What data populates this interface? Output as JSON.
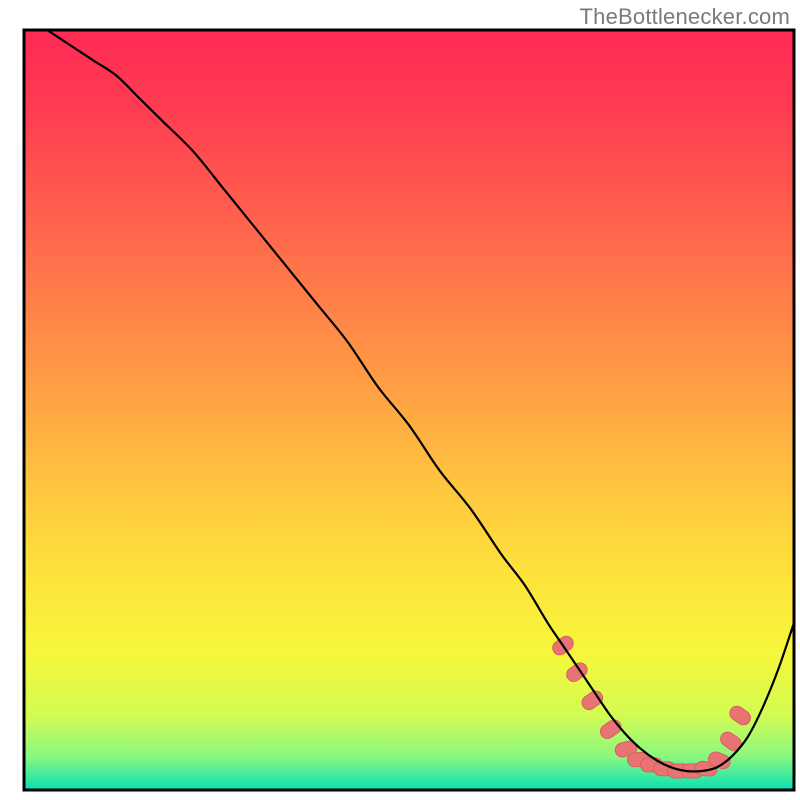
{
  "attribution": "TheBottlenecker.com",
  "chart_data": {
    "type": "line",
    "title": "",
    "xlabel": "",
    "ylabel": "",
    "xlim": [
      0,
      100
    ],
    "ylim": [
      0,
      100
    ],
    "grid": false,
    "background": {
      "type": "vertical-gradient",
      "stops": [
        {
          "offset": 0.0,
          "color": "#ff2a55"
        },
        {
          "offset": 0.1,
          "color": "#ff3b52"
        },
        {
          "offset": 0.22,
          "color": "#ff5a4e"
        },
        {
          "offset": 0.35,
          "color": "#ff7d49"
        },
        {
          "offset": 0.48,
          "color": "#ffa244"
        },
        {
          "offset": 0.6,
          "color": "#ffc53f"
        },
        {
          "offset": 0.72,
          "color": "#fee33b"
        },
        {
          "offset": 0.82,
          "color": "#f6f73b"
        },
        {
          "offset": 0.9,
          "color": "#d4fb51"
        },
        {
          "offset": 0.955,
          "color": "#8cf87f"
        },
        {
          "offset": 0.985,
          "color": "#34e9a3"
        },
        {
          "offset": 1.0,
          "color": "#05dfb6"
        }
      ]
    },
    "axis_border": true,
    "series": [
      {
        "name": "bottleneck-curve",
        "color": "#000000",
        "stroke_width": 2.2,
        "x": [
          3,
          6,
          9,
          12,
          15,
          18,
          22,
          26,
          30,
          34,
          38,
          42,
          46,
          50,
          54,
          58,
          62,
          65,
          68,
          70,
          72,
          74,
          76,
          78,
          80,
          82,
          84,
          86,
          88,
          90,
          92,
          94,
          96,
          98,
          100
        ],
        "y": [
          100,
          98,
          96,
          94,
          91,
          88,
          84,
          79,
          74,
          69,
          64,
          59,
          53,
          48,
          42,
          37,
          31,
          27,
          22,
          19,
          16,
          13,
          10,
          7.5,
          5.5,
          4,
          3,
          2.5,
          2.5,
          3,
          4.5,
          7,
          11,
          16,
          22
        ]
      }
    ],
    "markers": {
      "name": "highlight-dots",
      "shape": "pill",
      "fill": "#e77472",
      "stroke": "#d95f5d",
      "width": 14,
      "height": 22,
      "points": [
        {
          "x": 70.0,
          "y": 19.0,
          "rot": 55
        },
        {
          "x": 71.8,
          "y": 15.5,
          "rot": 55
        },
        {
          "x": 73.8,
          "y": 11.8,
          "rot": 55
        },
        {
          "x": 76.2,
          "y": 8.0,
          "rot": 55
        },
        {
          "x": 78.2,
          "y": 5.4,
          "rot": 75
        },
        {
          "x": 79.8,
          "y": 4.0,
          "rot": 88
        },
        {
          "x": 81.5,
          "y": 3.3,
          "rot": 90
        },
        {
          "x": 83.2,
          "y": 2.8,
          "rot": 90
        },
        {
          "x": 85.0,
          "y": 2.5,
          "rot": 90
        },
        {
          "x": 86.8,
          "y": 2.5,
          "rot": 90
        },
        {
          "x": 88.6,
          "y": 2.8,
          "rot": 95
        },
        {
          "x": 90.3,
          "y": 3.9,
          "rot": 110
        },
        {
          "x": 91.8,
          "y": 6.4,
          "rot": 125
        },
        {
          "x": 93.0,
          "y": 9.8,
          "rot": 125
        }
      ]
    }
  }
}
